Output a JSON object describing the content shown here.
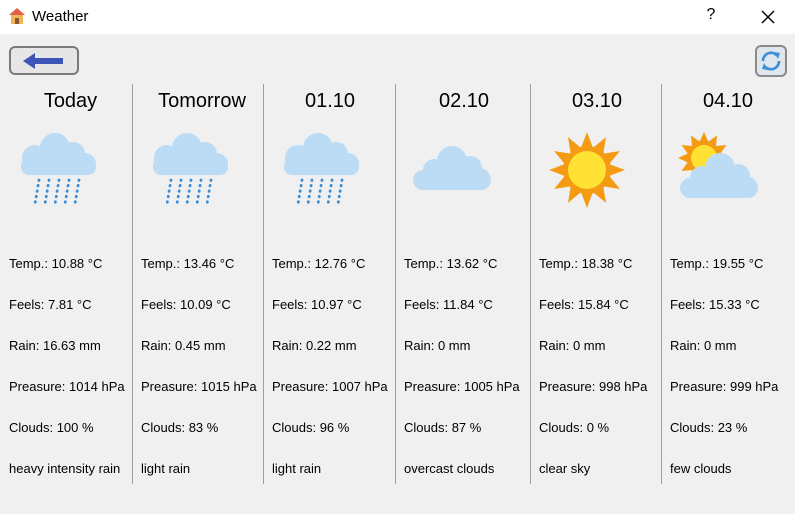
{
  "window": {
    "title": "Weather",
    "help_label": "?"
  },
  "labels": {
    "temp": "Temp.: ",
    "feels": "Feels: ",
    "rain": "Rain: ",
    "pressure": "Preasure: ",
    "clouds": "Clouds: "
  },
  "days": [
    {
      "title": "Today",
      "icon": "rain-cloud-icon",
      "temp": "10.88 °C",
      "feels": "7.81 °C",
      "rain": "16.63 mm",
      "pressure": "1014 hPa",
      "clouds": "100 %",
      "description": "heavy intensity rain"
    },
    {
      "title": "Tomorrow",
      "icon": "rain-cloud-icon",
      "temp": "13.46 °C",
      "feels": "10.09 °C",
      "rain": "0.45 mm",
      "pressure": "1015 hPa",
      "clouds": "83 %",
      "description": "light rain"
    },
    {
      "title": "01.10",
      "icon": "rain-cloud-icon",
      "temp": "12.76 °C",
      "feels": "10.97 °C",
      "rain": "0.22 mm",
      "pressure": "1007 hPa",
      "clouds": "96 %",
      "description": "light rain"
    },
    {
      "title": "02.10",
      "icon": "cloud-icon",
      "temp": "13.62 °C",
      "feels": "11.84 °C",
      "rain": "0 mm",
      "pressure": "1005 hPa",
      "clouds": "87 %",
      "description": "overcast clouds"
    },
    {
      "title": "03.10",
      "icon": "sun-icon",
      "temp": "18.38 °C",
      "feels": "15.84 °C",
      "rain": "0 mm",
      "pressure": "998 hPa",
      "clouds": "0 %",
      "description": "clear sky"
    },
    {
      "title": "04.10",
      "icon": "sun-cloud-icon",
      "temp": "19.55 °C",
      "feels": "15.33 °C",
      "rain": "0 mm",
      "pressure": "999 hPa",
      "clouds": "23 %",
      "description": "few clouds"
    }
  ],
  "colors": {
    "cloud": "#bcdcf5",
    "rain": "#3b8fd6",
    "sun": "#ffe234",
    "sun_rays": "#f59a13",
    "arrow": "#3d55b8"
  }
}
